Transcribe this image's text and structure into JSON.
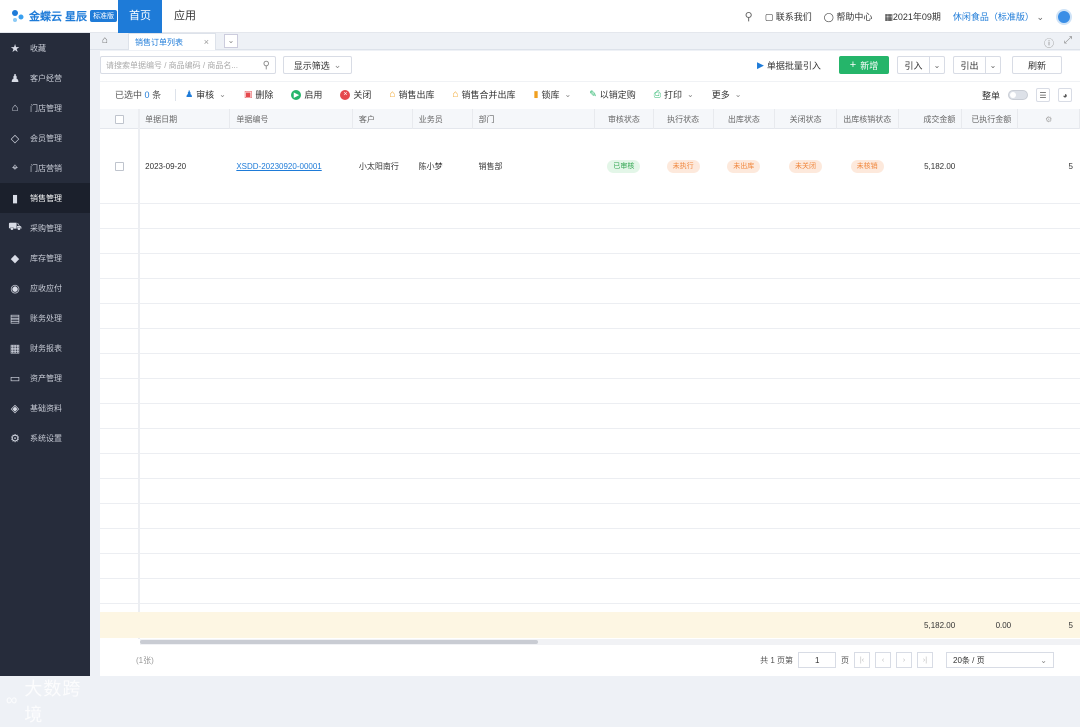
{
  "topbar": {
    "brand": "金蝶云 星辰",
    "edition_badge": "标准版",
    "nav_home": "首页",
    "nav_apps": "应用",
    "contact": "联系我们",
    "help": "帮助中心",
    "period": "2021年09期",
    "company": "休闲食品（标准版）"
  },
  "sidebar": {
    "items": [
      {
        "label": "收藏",
        "icon": "star-icon"
      },
      {
        "label": "客户经营",
        "icon": "customer-icon"
      },
      {
        "label": "门店管理",
        "icon": "store-icon"
      },
      {
        "label": "会员管理",
        "icon": "member-icon"
      },
      {
        "label": "门店营销",
        "icon": "tag-icon"
      },
      {
        "label": "销售管理",
        "icon": "bar-chart-icon"
      },
      {
        "label": "采购管理",
        "icon": "cart-icon"
      },
      {
        "label": "库存管理",
        "icon": "cube-icon"
      },
      {
        "label": "应收应付",
        "icon": "coin-icon"
      },
      {
        "label": "账务处理",
        "icon": "ledger-icon"
      },
      {
        "label": "财务报表",
        "icon": "report-icon"
      },
      {
        "label": "资产管理",
        "icon": "asset-icon"
      },
      {
        "label": "基础资料",
        "icon": "layers-icon"
      },
      {
        "label": "系统设置",
        "icon": "gear-icon"
      }
    ],
    "watermark": "大数跨境"
  },
  "tabs": {
    "active_tab": "销售订单列表"
  },
  "search": {
    "placeholder": "请搜索单据编号 / 商品编码 / 商品名..."
  },
  "actions": {
    "filter": "显示筛选",
    "batch_import": "单据批量引入",
    "new": "新增",
    "import": "引入",
    "export": "引出",
    "refresh": "刷新"
  },
  "toolbar": {
    "selected_prefix": "已选中",
    "selected_count": "0",
    "selected_suffix": "条",
    "audit": "审核",
    "delete": "删除",
    "enable": "启用",
    "close": "关闭",
    "outbound": "销售出库",
    "merge_outbound": "销售合并出库",
    "lock": "锁库",
    "purchase": "以销定购",
    "print": "打印",
    "more": "更多",
    "whole_order": "整单"
  },
  "table": {
    "columns": [
      "单据日期",
      "单据编号",
      "客户",
      "业务员",
      "部门",
      "审核状态",
      "执行状态",
      "出库状态",
      "关闭状态",
      "出库核销状态",
      "成交金额",
      "已执行金额"
    ],
    "rows": [
      {
        "date": "2023-09-20",
        "number": "XSDD-20230920-00001",
        "customer": "小太阳南行",
        "salesman": "陈小梦",
        "dept": "销售部",
        "audit": "已审核",
        "exec": "未执行",
        "outbound": "未出库",
        "closed": "未关闭",
        "writeoff": "未核销",
        "amount": "5,182.00",
        "executed": "",
        "overflow": "5"
      }
    ],
    "footer": {
      "amount": "5,182.00",
      "executed": "0.00",
      "overflow": "5"
    }
  },
  "pager": {
    "count_text": "(1张)",
    "total_pages": "共 1 页第",
    "current_page": "1",
    "page_suffix": "页",
    "page_size": "20条 / 页"
  },
  "colors": {
    "primary": "#1e7bd8",
    "green": "#25b56a",
    "sidebar": "#262c3b"
  }
}
